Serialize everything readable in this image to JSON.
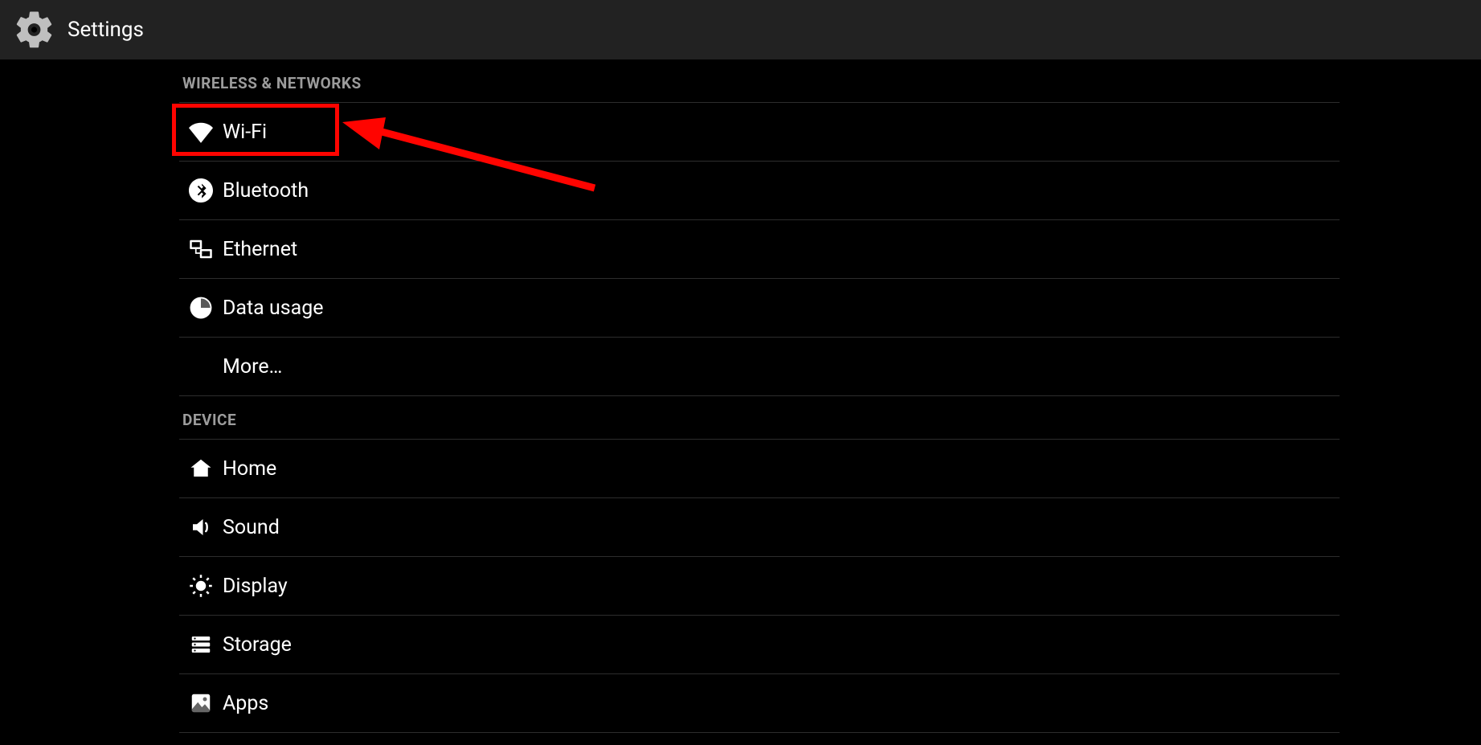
{
  "header": {
    "title": "Settings"
  },
  "sections": [
    {
      "title": "WIRELESS & NETWORKS",
      "items": [
        {
          "id": "wifi",
          "label": "Wi-Fi",
          "icon": "wifi-icon"
        },
        {
          "id": "bluetooth",
          "label": "Bluetooth",
          "icon": "bluetooth-icon"
        },
        {
          "id": "ethernet",
          "label": "Ethernet",
          "icon": "ethernet-icon"
        },
        {
          "id": "datausage",
          "label": "Data usage",
          "icon": "data-usage-icon"
        },
        {
          "id": "more",
          "label": "More…",
          "icon": ""
        }
      ]
    },
    {
      "title": "DEVICE",
      "items": [
        {
          "id": "home",
          "label": "Home",
          "icon": "home-icon"
        },
        {
          "id": "sound",
          "label": "Sound",
          "icon": "sound-icon"
        },
        {
          "id": "display",
          "label": "Display",
          "icon": "display-icon"
        },
        {
          "id": "storage",
          "label": "Storage",
          "icon": "storage-icon"
        },
        {
          "id": "apps",
          "label": "Apps",
          "icon": "apps-icon"
        }
      ]
    }
  ],
  "annotations": {
    "highlight_target": "wifi",
    "highlight_color": "#ff0400"
  }
}
